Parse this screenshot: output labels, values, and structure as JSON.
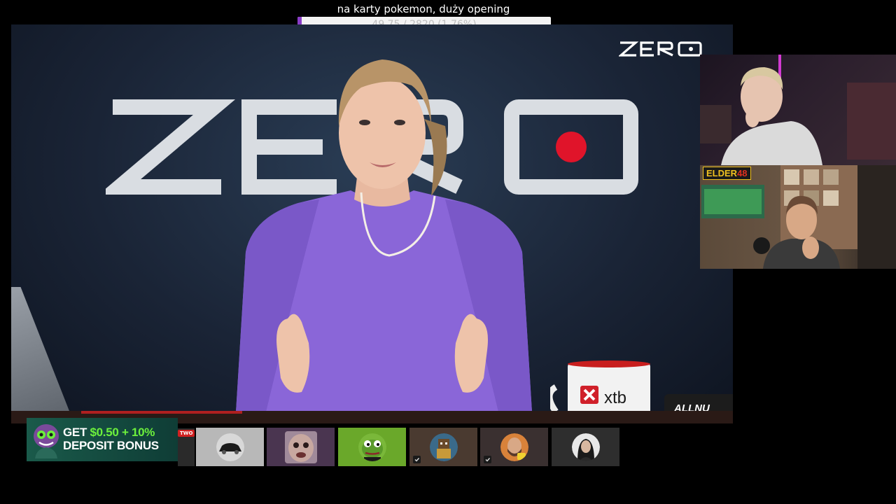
{
  "goal": {
    "title": "na karty pokemon, duży opening",
    "progress_text": "49.75 / 2820 (1.76%)",
    "progress_fraction": 0.0176,
    "fill_color": "#8a3cc8"
  },
  "main_video": {
    "brand_logo": "ZERO",
    "mug_label": "xtb",
    "desk_sign": "ALLNU"
  },
  "webcams": {
    "elder_badge_word": "ELDER",
    "elder_badge_num": "48"
  },
  "promo": {
    "line1_prefix": "GET ",
    "line1_amount": "$0.50 + 10%",
    "line2": "DEPOSIT BONUS",
    "tag": "TWO"
  },
  "thumbnails": [
    {
      "icon": "car-icon",
      "bg": "#b8b8b8"
    },
    {
      "icon": "gremlin-face-icon",
      "bg": "#4a3550"
    },
    {
      "icon": "pepe-frog-icon",
      "bg": "#6aa82a"
    },
    {
      "icon": "pixel-character-icon",
      "bg": "#4a3a30"
    },
    {
      "icon": "bearded-man-icon",
      "bg": "#3a3030"
    },
    {
      "icon": "woman-portrait-icon",
      "bg": "#2e2e2e"
    }
  ]
}
